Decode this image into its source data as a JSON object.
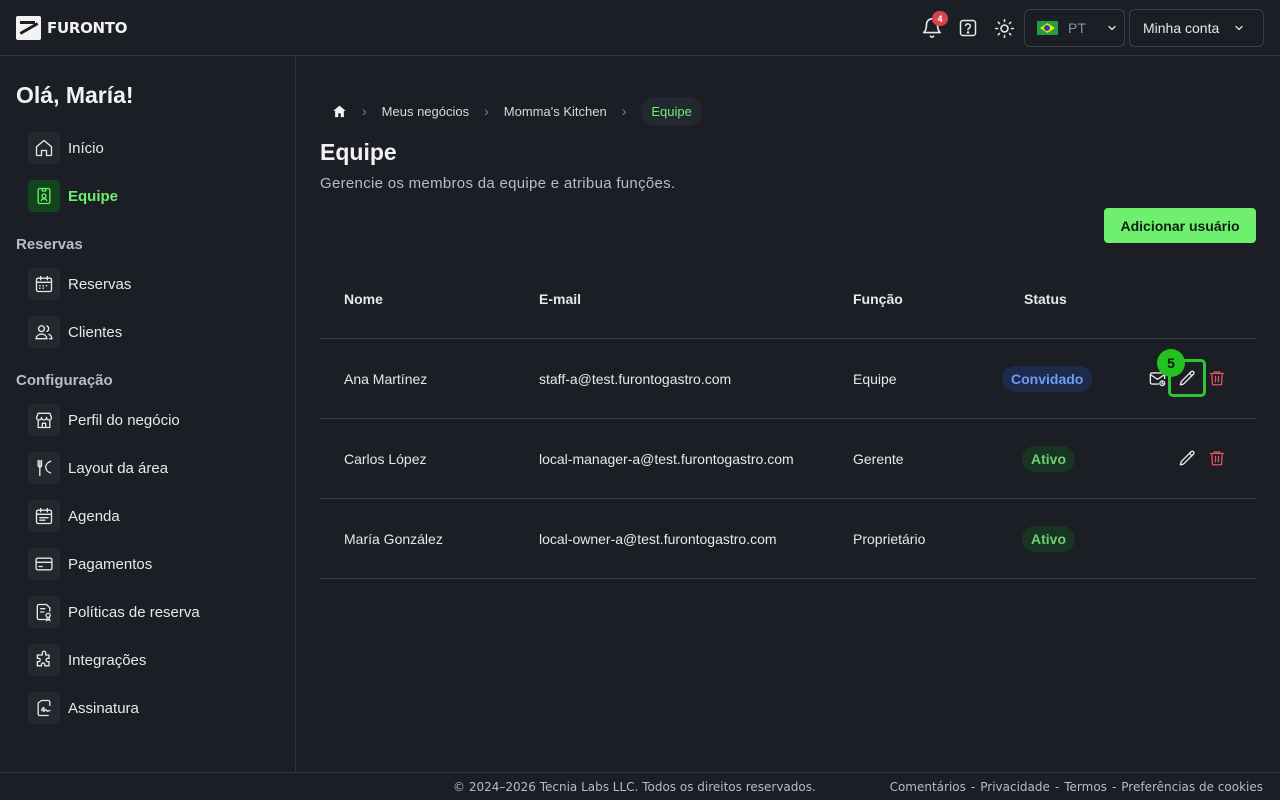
{
  "header": {
    "brand": "FURONTO",
    "notifications_count": "4",
    "language": {
      "code": "PT"
    },
    "account_label": "Minha conta"
  },
  "sidebar": {
    "greeting": "Olá, María!",
    "items_main": [
      {
        "label": "Início",
        "icon": "home-icon"
      },
      {
        "label": "Equipe",
        "icon": "badge-icon",
        "active": true
      }
    ],
    "section_reservas": "Reservas",
    "items_reservas": [
      {
        "label": "Reservas",
        "icon": "calendar-icon"
      },
      {
        "label": "Clientes",
        "icon": "users-icon"
      }
    ],
    "section_config": "Configuração",
    "items_config": [
      {
        "label": "Perfil do negócio",
        "icon": "store-icon"
      },
      {
        "label": "Layout da área",
        "icon": "utensils-icon"
      },
      {
        "label": "Agenda",
        "icon": "calendar-list-icon"
      },
      {
        "label": "Pagamentos",
        "icon": "credit-card-icon"
      },
      {
        "label": "Políticas de reserva",
        "icon": "policy-icon"
      },
      {
        "label": "Integrações",
        "icon": "puzzle-icon"
      },
      {
        "label": "Assinatura",
        "icon": "signature-icon"
      }
    ]
  },
  "breadcrumb": {
    "items": [
      "Meus negócios",
      "Momma's Kitchen"
    ],
    "current": "Equipe"
  },
  "page": {
    "title": "Equipe",
    "subtitle": "Gerencie os membros da equipe e atribua funções.",
    "add_button": "Adicionar usuário"
  },
  "table": {
    "headers": {
      "name": "Nome",
      "email": "E-mail",
      "role": "Função",
      "status": "Status"
    },
    "rows": [
      {
        "name": "Ana Martínez",
        "email": "staff-a@test.furontogastro.com",
        "role": "Equipe",
        "status": "Convidado"
      },
      {
        "name": "Carlos López",
        "email": "local-manager-a@test.furontogastro.com",
        "role": "Gerente",
        "status": "Ativo"
      },
      {
        "name": "María González",
        "email": "local-owner-a@test.furontogastro.com",
        "role": "Proprietário",
        "status": "Ativo"
      }
    ],
    "step_marker": "5"
  },
  "footer": {
    "copyright": "© 2024–2026 Tecnia Labs LLC. Todos os direitos reservados.",
    "links": [
      "Comentários",
      "Privacidade",
      "Termos",
      "Preferências de cookies"
    ],
    "separator": "-"
  },
  "colors": {
    "accent": "#6ef06e",
    "background": "#1b1e24",
    "danger": "#e0555c",
    "invited": "#6f9cf0"
  }
}
